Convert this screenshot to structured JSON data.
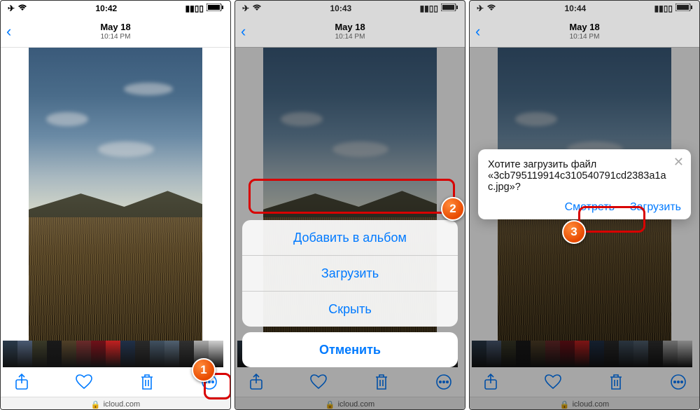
{
  "screens": [
    {
      "status_time": "10:42"
    },
    {
      "status_time": "10:43"
    },
    {
      "status_time": "10:44"
    }
  ],
  "header": {
    "date": "May 18",
    "time": "10:14 PM"
  },
  "address": "icloud.com",
  "action_sheet": {
    "add_to_album": "Добавить в альбом",
    "download": "Загрузить",
    "hide": "Скрыть",
    "cancel": "Отменить"
  },
  "dialog": {
    "message": "Хотите загрузить файл «3cb795119914c310540791cd2383a1ac.jpg»?",
    "view": "Смотреть",
    "download": "Загрузить"
  },
  "markers": {
    "m1": "1",
    "m2": "2",
    "m3": "3"
  },
  "thumb_colors": [
    "#2a3a4a",
    "#4a5a72",
    "#3a3a28",
    "#1a1a1a",
    "#504028",
    "#6a2a2a",
    "#701018",
    "#c02020",
    "#203048",
    "#2a2a2a",
    "#405060",
    "#506070",
    "#303030",
    "#aaaaaa",
    "#d0d0d0"
  ]
}
